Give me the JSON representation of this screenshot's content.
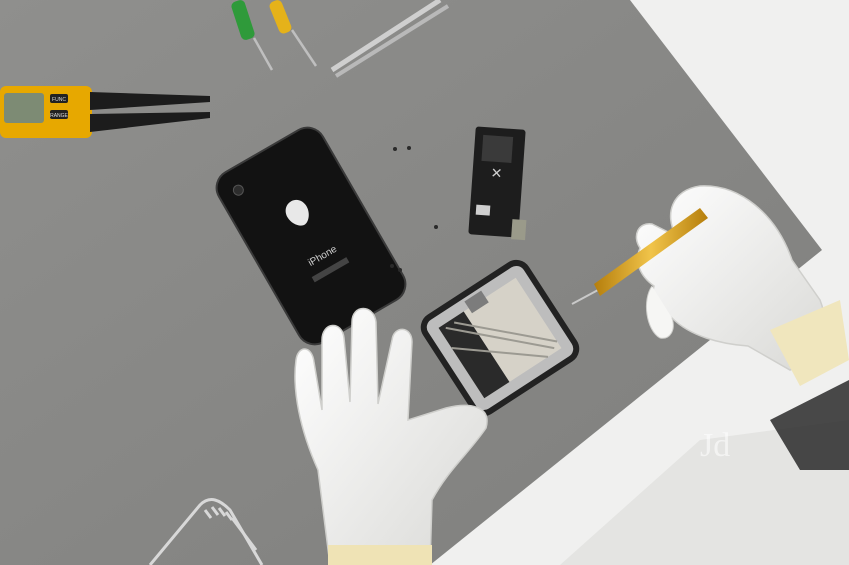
{
  "scene": {
    "colors": {
      "mat": "#8a8a88",
      "table": "#ececec",
      "glove": "#f4f4f2",
      "phone_back": "#141414",
      "gold": "#d9a21c",
      "tester_yellow": "#e7a800"
    },
    "phone_back_label": "iPhone",
    "tester_labels": [
      "FUNC",
      "RANGE"
    ],
    "watermark": "Jd"
  }
}
